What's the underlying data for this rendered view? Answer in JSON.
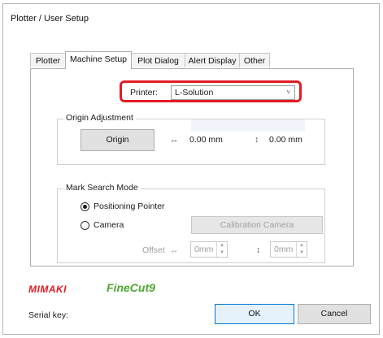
{
  "window": {
    "title": "Plotter / User Setup"
  },
  "tabs": [
    {
      "label": "Plotter"
    },
    {
      "label": "Machine Setup"
    },
    {
      "label": "Plot Dialog"
    },
    {
      "label": "Alert Display"
    },
    {
      "label": "Other"
    }
  ],
  "printer": {
    "label": "Printer:",
    "value": "L-Solution",
    "chevron": "˅"
  },
  "origin_adjustment": {
    "label": "Origin Adjustment",
    "button": "Origin",
    "x_icon": "↔",
    "x_value": "0.00 mm",
    "y_icon": "↕",
    "y_value": "0.00 mm"
  },
  "mark_search": {
    "label": "Mark Search Mode",
    "options": [
      {
        "label": "Positioning Pointer",
        "selected": true
      },
      {
        "label": "Camera",
        "selected": false
      }
    ],
    "calibration_button": "Calibration Camera",
    "offset_label": "Offset",
    "offset_x_icon": "↔",
    "offset_x": "0mm",
    "offset_y_icon": "↕",
    "offset_y": "0mm"
  },
  "brand": {
    "mimaki": "MIMAKI",
    "finecut": "FineCut9"
  },
  "serial_key_label": "Serial key:",
  "buttons": {
    "ok": "OK",
    "cancel": "Cancel"
  },
  "colors": {
    "highlight": "#e11c24",
    "mimaki_red": "#e11c24",
    "finecut_green": "#4fa62f"
  },
  "icons": {
    "dropdown": "chevron-down-icon",
    "spin_up": "spin-up-icon",
    "spin_down": "spin-down-icon"
  }
}
